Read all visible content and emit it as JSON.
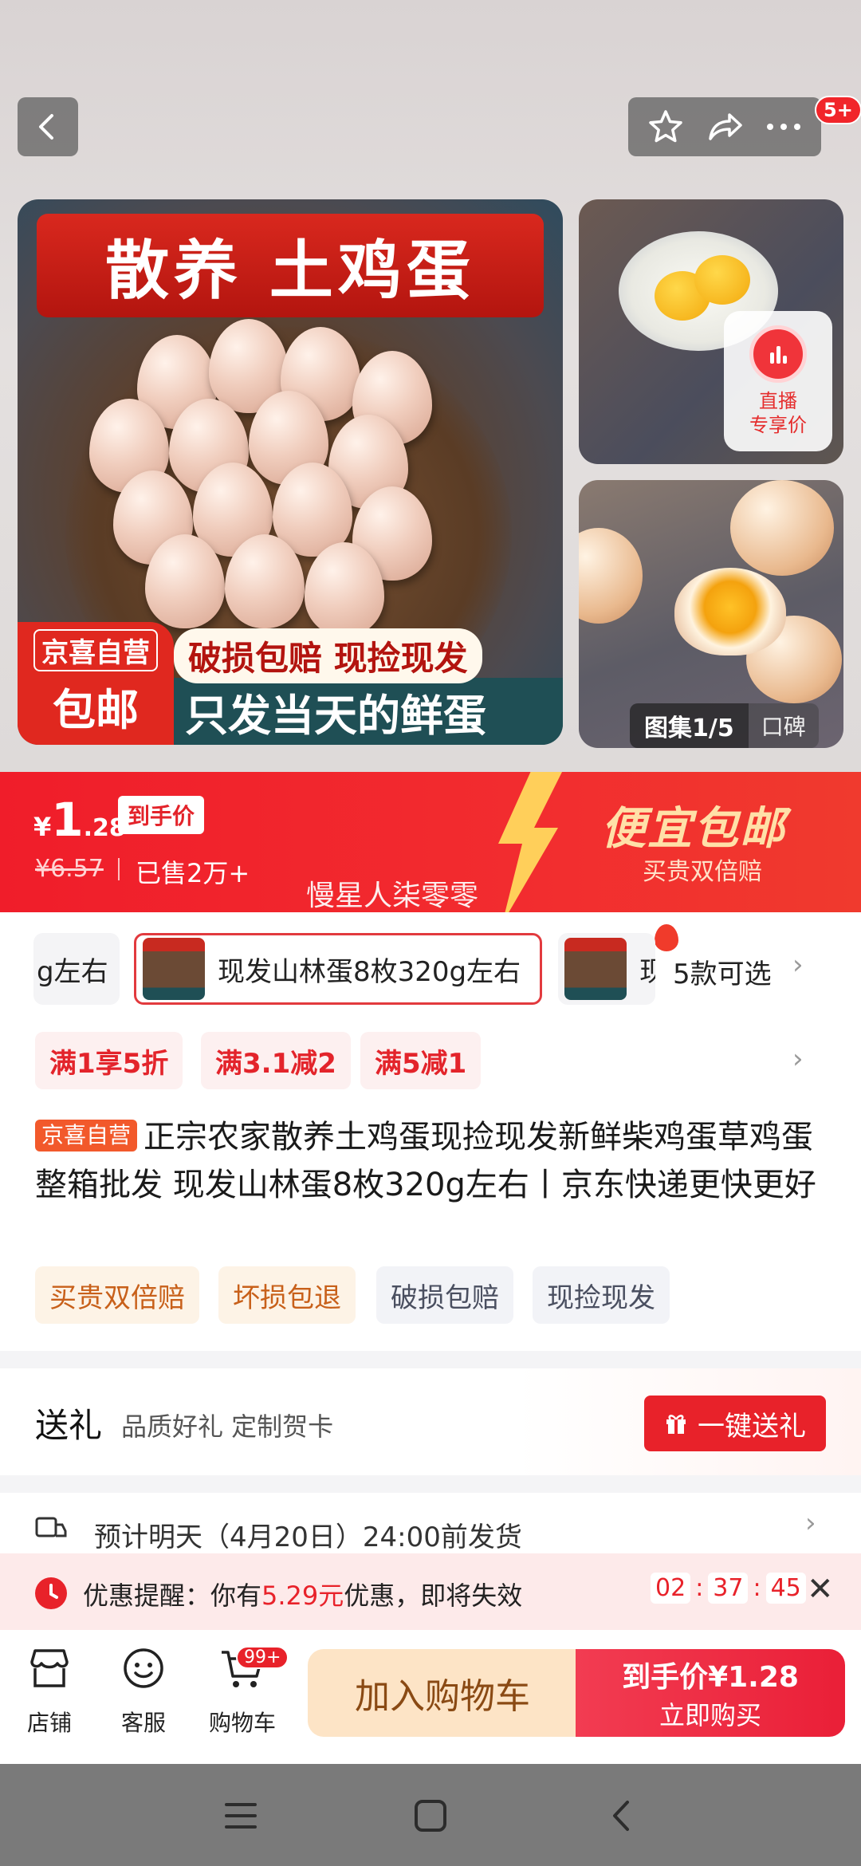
{
  "gallery": {
    "main_banner": "散养 土鸡蛋",
    "promo_store_line1": "京喜自营",
    "promo_store_line2": "包邮",
    "promo_pill": "破损包赔 现捡现发",
    "promo_bar": "只发当天的鲜蛋",
    "live_line1": "直播",
    "live_line2": "专享价",
    "gallery_count": "图集1/5",
    "reviews_tab": "口碑",
    "more_badge": "5+",
    "icons": [
      "back-icon",
      "star-icon",
      "share-icon",
      "more-icon"
    ]
  },
  "price": {
    "currency": "¥",
    "integer": "1",
    "decimal": ".28",
    "tag": "到手价",
    "original": "¥6.57",
    "sold": "已售2万+",
    "slogan_main": "便宜包邮",
    "slogan_sub": "买贵双倍赔",
    "watermark": "慢星人柒零零"
  },
  "variants": {
    "left_partial": "g左右",
    "selected": "现发山林蛋8枚320g左右",
    "right_partial": "现",
    "count": "5款可选"
  },
  "coupons": [
    "满1享5折",
    "满3.1减2",
    "满5减1"
  ],
  "product": {
    "self_tag": "京喜自营",
    "title": "正宗农家散养土鸡蛋现捡现发新鲜柴鸡蛋草鸡蛋整箱批发 现发山林蛋8枚320g左右丨京东快递更快更好",
    "tags": [
      "买贵双倍赔",
      "坏损包退",
      "破损包赔",
      "现捡现发"
    ]
  },
  "gift": {
    "title": "送礼",
    "subtitle": "品质好礼 定制贺卡",
    "button": "一键送礼"
  },
  "shipping": {
    "text": "预计明天（4月20日）24:00前发货"
  },
  "reminder": {
    "prefix": "优惠提醒：你有",
    "amount": "5.29元",
    "suffix": "优惠，即将失效",
    "timer": [
      "02",
      "37",
      "45"
    ]
  },
  "bottom": {
    "store": "店铺",
    "service": "客服",
    "cart": "购物车",
    "cart_badge": "99+",
    "add_cart": "加入购物车",
    "buy_line1": "到手价¥1.28",
    "buy_line2": "立即购买"
  },
  "colors": {
    "brand_red": "#e8222a",
    "price_banner": "#f01d2a",
    "add_cart_bg": "#fde4c6"
  }
}
